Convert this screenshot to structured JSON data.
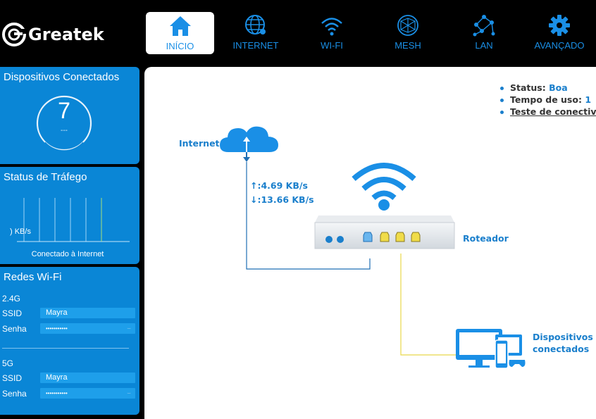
{
  "brand": {
    "name": "Greatek"
  },
  "nav": [
    {
      "label": "INÍCIO",
      "icon": "home-icon",
      "active": true
    },
    {
      "label": "INTERNET",
      "icon": "globe-icon"
    },
    {
      "label": "WI-FI",
      "icon": "wifi-icon"
    },
    {
      "label": "MESH",
      "icon": "mesh-icon"
    },
    {
      "label": "LAN",
      "icon": "lan-icon"
    },
    {
      "label": "AVANÇADO",
      "icon": "gear-icon"
    }
  ],
  "devices_panel": {
    "title": "Dispositivos Conectados",
    "count": "7",
    "sub": "---"
  },
  "traffic_panel": {
    "title": "Status de Tráfego",
    "axis_label": ") KB/s",
    "caption": "Conectado à Internet"
  },
  "wifi_panel": {
    "title": "Redes Wi-Fi",
    "bands": [
      {
        "band": "2.4G",
        "ssid_label": "SSID",
        "ssid": "Mayra",
        "pass_label": "Senha",
        "pass": "•••••••••••"
      },
      {
        "band": "5G",
        "ssid_label": "SSID",
        "ssid": "Mayra",
        "pass_label": "Senha",
        "pass": "•••••••••••"
      }
    ]
  },
  "status": {
    "status_label": "Status:",
    "status_value": "Boa",
    "uptime_label": "Tempo de uso:",
    "uptime_value": "1",
    "test_link": "Teste de conectivi"
  },
  "diagram": {
    "internet_label": "Internet",
    "upload": "↑:4.69 KB/s",
    "download": "↓:13.66 KB/s",
    "router_label": "Roteador",
    "devices_label_1": "Dispositivos",
    "devices_label_2": "conectados"
  },
  "colors": {
    "accent": "#1a8fe6",
    "panel": "#0a86d6",
    "line_yellow": "#e8d84a",
    "line_blue": "#1f6fb5"
  }
}
